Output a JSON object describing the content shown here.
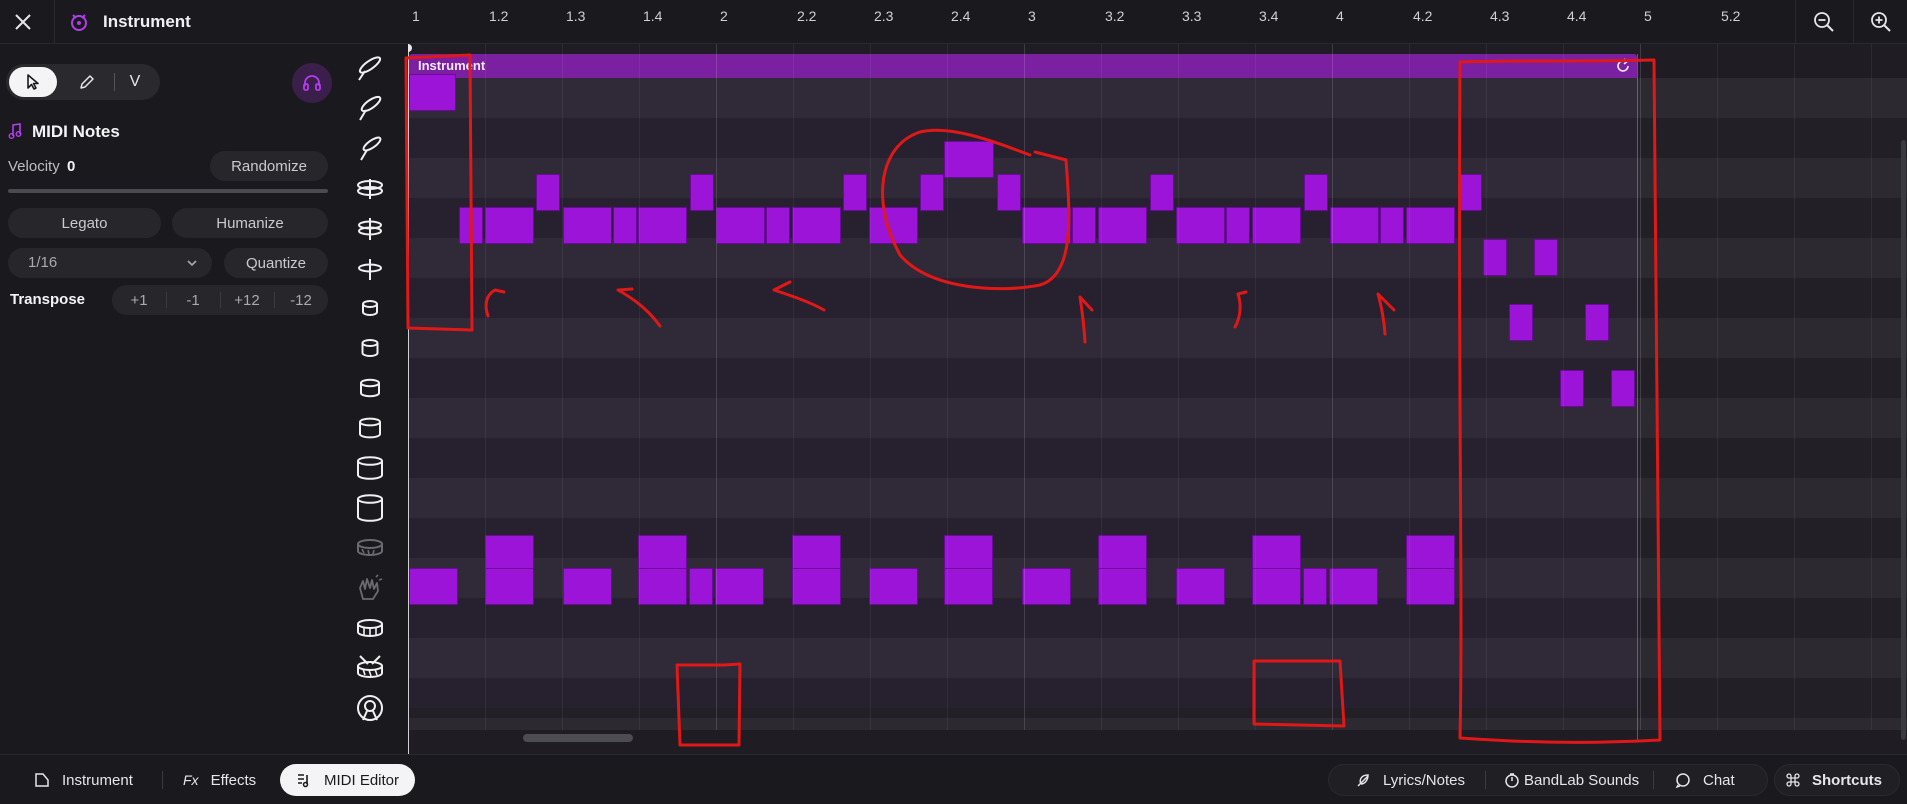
{
  "header": {
    "title": "Instrument"
  },
  "left_panel": {
    "tools": {
      "select": "select-tool",
      "pencil": "pencil-tool",
      "velocity": "V"
    },
    "section_title": "MIDI Notes",
    "velocity_label": "Velocity",
    "velocity_value": "0",
    "randomize_label": "Randomize",
    "legato_label": "Legato",
    "humanize_label": "Humanize",
    "grid_value": "1/16",
    "quantize_label": "Quantize",
    "transpose_label": "Transpose",
    "transpose_buttons": [
      "+1",
      "-1",
      "+12",
      "-12"
    ]
  },
  "ruler": {
    "labels": [
      "1",
      "1.2",
      "1.3",
      "1.4",
      "2",
      "2.2",
      "2.3",
      "2.4",
      "3",
      "3.2",
      "3.3",
      "3.4",
      "4",
      "4.2",
      "4.3",
      "4.4",
      "5",
      "5.2"
    ]
  },
  "region": {
    "label": "Instrument"
  },
  "drum_lanes": [
    "crash-cymbal-1",
    "crash-cymbal-2",
    "crash-cymbal-3",
    "ride-cymbal",
    "open-hihat",
    "closed-hihat",
    "tom-1",
    "tom-2",
    "tom-3",
    "tom-4",
    "floor-tom-1",
    "floor-tom-2",
    "rim",
    "clap",
    "snare",
    "snare-2",
    "kick"
  ],
  "bottom": {
    "instrument_label": "Instrument",
    "effects_label": "Effects",
    "midi_editor_label": "MIDI Editor",
    "lyrics_label": "Lyrics/Notes",
    "sounds_label": "BandLab Sounds",
    "chat_label": "Chat",
    "shortcuts_label": "Shortcuts"
  },
  "colors": {
    "note": "#9b14d8",
    "region": "#7a20a0",
    "annotation": "#e01818",
    "accent": "#b43cf0"
  }
}
